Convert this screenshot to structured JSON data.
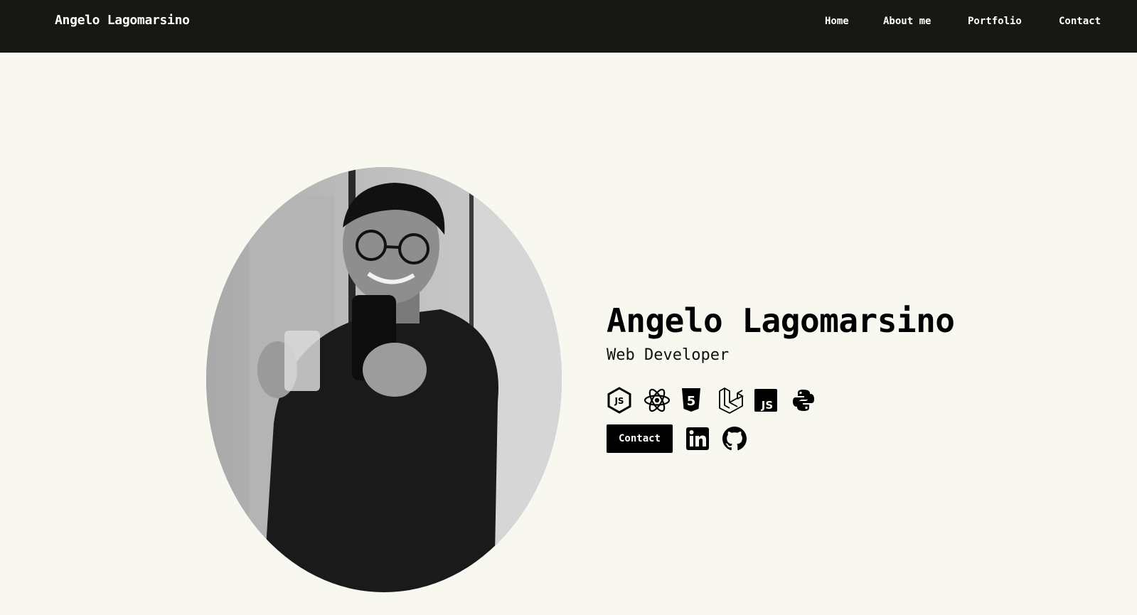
{
  "navbar": {
    "brand": "Angelo Lagomarsino",
    "links": [
      {
        "label": "Home"
      },
      {
        "label": "About me"
      },
      {
        "label": "Portfolio"
      },
      {
        "label": "Contact"
      }
    ]
  },
  "hero": {
    "name": "Angelo Lagomarsino",
    "role": "Web Developer",
    "photo_icon": "profile-photo",
    "tech_icons": [
      "nodejs-icon",
      "react-icon",
      "html5-icon",
      "laravel-icon",
      "javascript-icon",
      "python-icon"
    ],
    "contact_button": "Contact",
    "social_icons": [
      "linkedin-icon",
      "github-icon"
    ]
  },
  "colors": {
    "navbar_bg": "#171714",
    "page_bg": "#f8f8f0",
    "text": "#000000",
    "button_bg": "#000000"
  }
}
